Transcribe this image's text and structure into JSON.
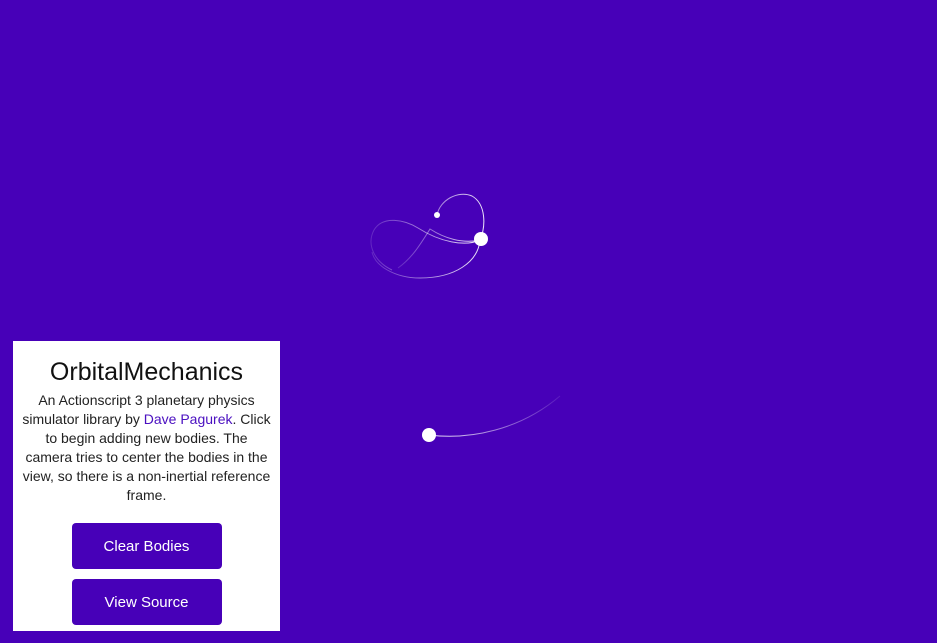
{
  "app": {
    "title": "OrbitalMechanics",
    "description_lines": {
      "part1": "An Actionscript 3 planetary physics simulator library by ",
      "author_link": "Dave Pagurek",
      "part2": ". Click to begin adding new bodies. The camera tries to center the bodies in the view, so there is a non-inertial reference frame."
    },
    "buttons": {
      "clear_label": "Clear Bodies",
      "source_label": "View Source"
    }
  },
  "colors": {
    "background": "#4700b8",
    "panel": "#ffffff",
    "button": "#4700b8",
    "body": "#ffffff"
  }
}
